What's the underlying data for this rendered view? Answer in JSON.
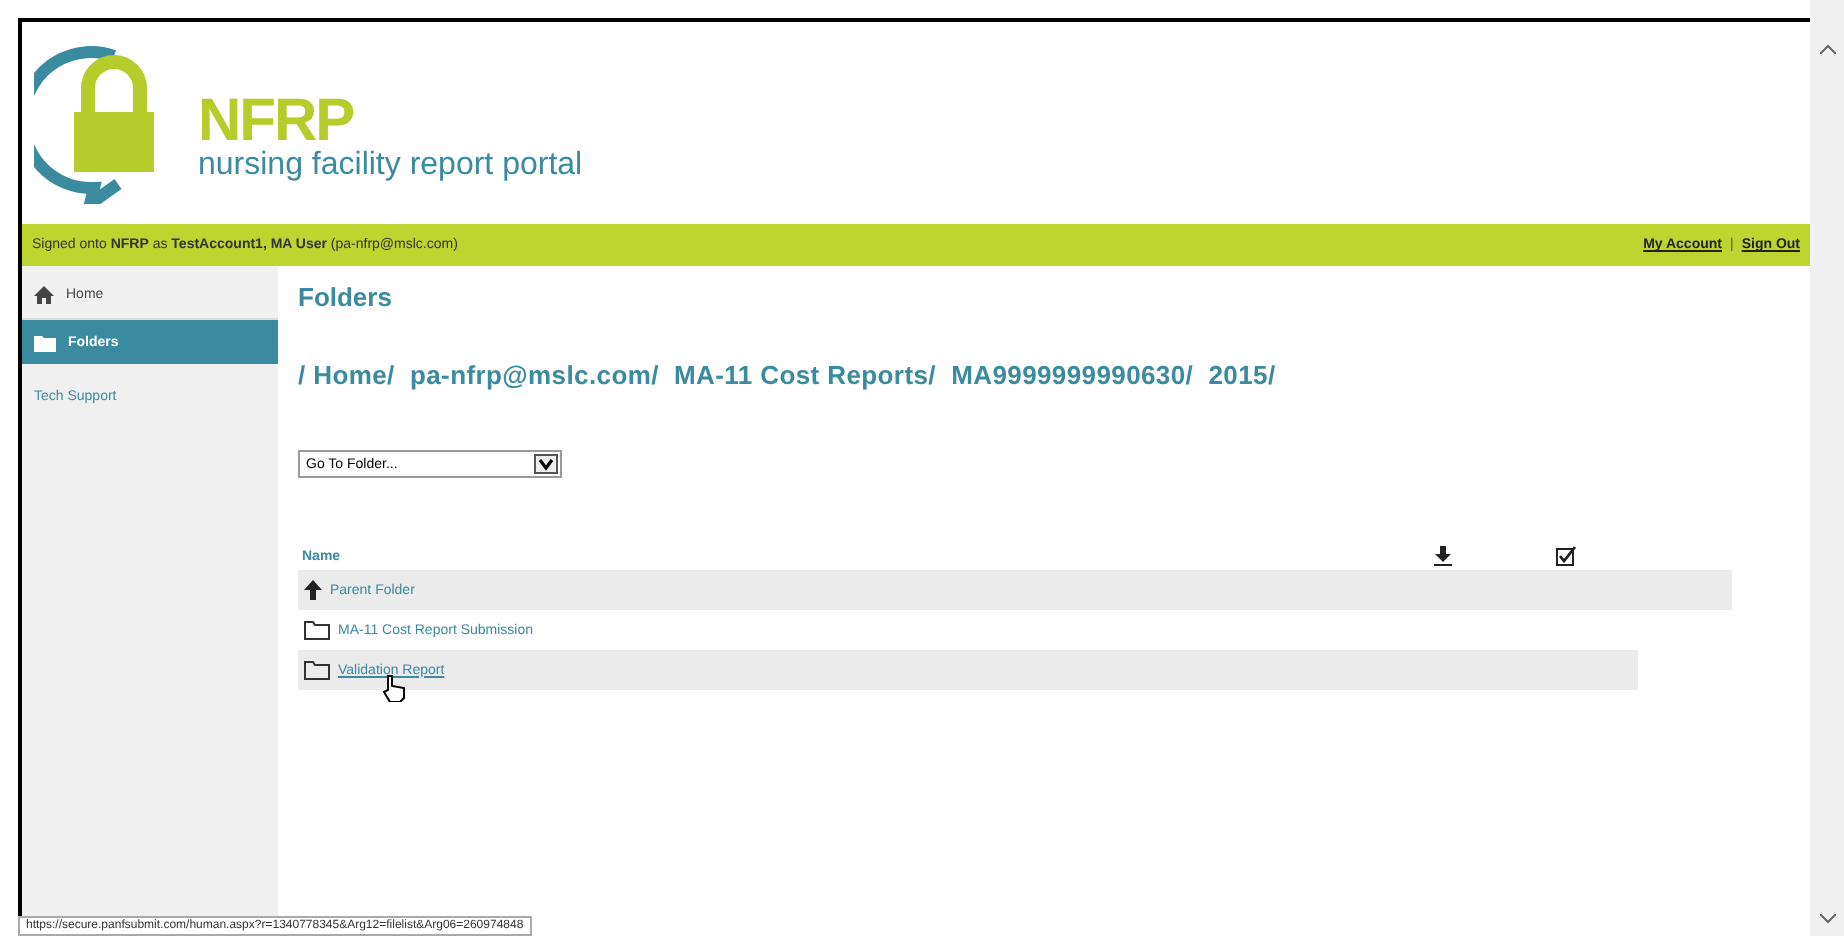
{
  "logo": {
    "mark": "NFRP",
    "tagline": "nursing facility report portal"
  },
  "user_bar": {
    "signed_in_text": "Signed onto **NFRP** as **TestAccount1, MA User** (pa-nfrp@mslc.com)",
    "links": [
      "My Account",
      "Sign Out"
    ],
    "separator": "|"
  },
  "sidebar": {
    "items": [
      {
        "label": "Home",
        "kind": "home",
        "selected": false
      },
      {
        "label": "Folders",
        "kind": "folder",
        "selected": true
      },
      {
        "label": "Tech Support",
        "kind": "plain",
        "selected": false
      }
    ]
  },
  "page_title": "Folders",
  "breadcrumb": "/ Home/  pa-nfrp@mslc.com/  MA-11 Cost Reports/  MA9999999990630/  2015/",
  "go_to_folder": {
    "value": "Go To Folder..."
  },
  "table": {
    "columns": [
      {
        "label": "Name",
        "kind": "text"
      },
      {
        "kind": "download"
      },
      {
        "kind": "check"
      }
    ],
    "rows": [
      {
        "label": "Parent Folder",
        "kind": "up",
        "hovered": false
      },
      {
        "label": "MA-11 Cost Report Submission",
        "kind": "folder",
        "hovered": false
      },
      {
        "label": "Validation Report",
        "kind": "folder",
        "hovered": true
      }
    ]
  },
  "status_bar": "https://secure.panfsubmit.com/human.aspx?r=1340778345&Arg12=filelist&Arg06=260974848"
}
